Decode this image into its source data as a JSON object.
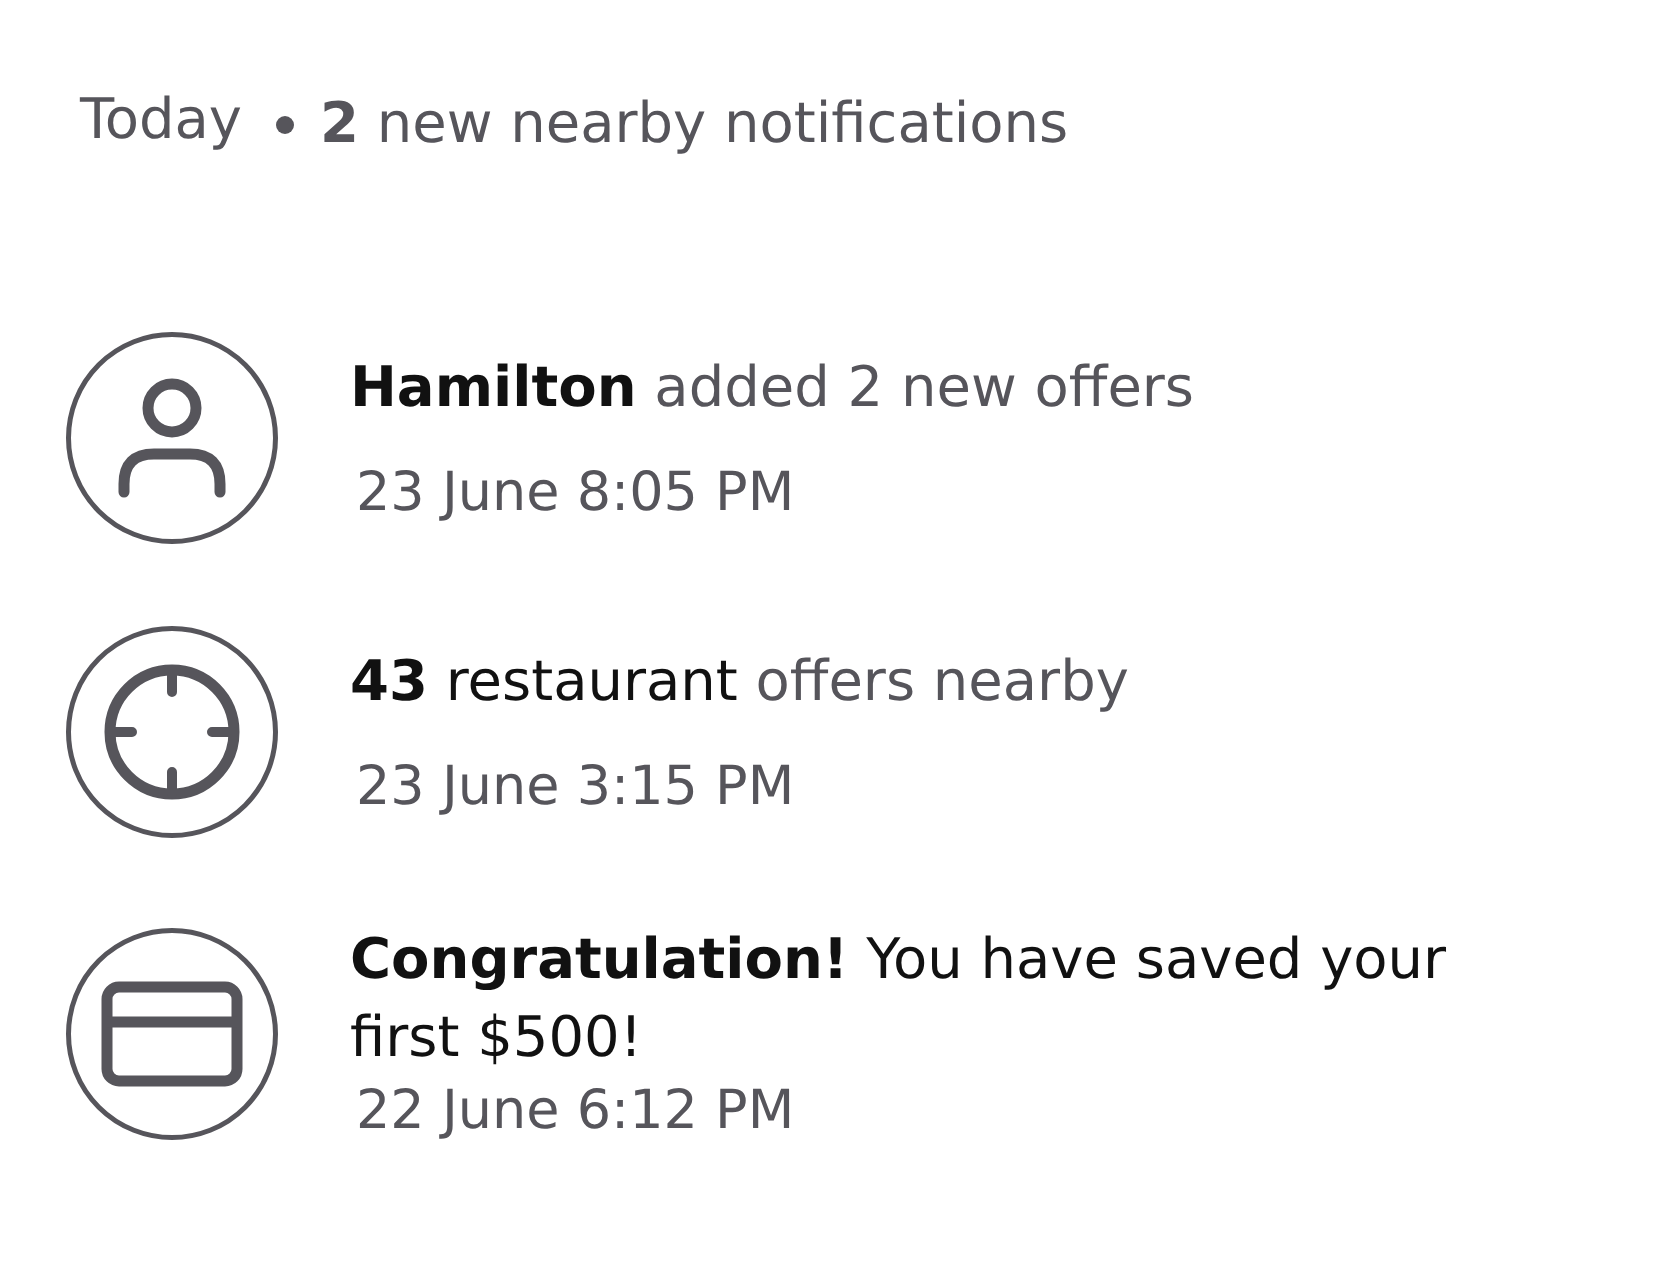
{
  "header": {
    "day": "Today",
    "summary": "**2** new nearby notifications"
  },
  "notifications": [
    {
      "kind": "profile",
      "message": [
        {
          "text": "Hamilton",
          "kind": "strong"
        },
        {
          "text": "added 2 new offers",
          "kind": "muted"
        }
      ],
      "time": "23 June 8:05 PM"
    },
    {
      "kind": "nearby",
      "message": [
        {
          "text": "43",
          "kind": "strong"
        },
        {
          "text": "restaurant",
          "kind": "plain"
        },
        {
          "text": "offers nearby",
          "kind": "muted"
        }
      ],
      "time": "23 June 3:15 PM"
    },
    {
      "kind": "payment",
      "message": [
        {
          "text": "Congratulation!",
          "kind": "strong"
        },
        {
          "text": "You have saved your first $500!",
          "kind": "plain"
        }
      ],
      "time": "22 June 6:12 PM"
    }
  ]
}
